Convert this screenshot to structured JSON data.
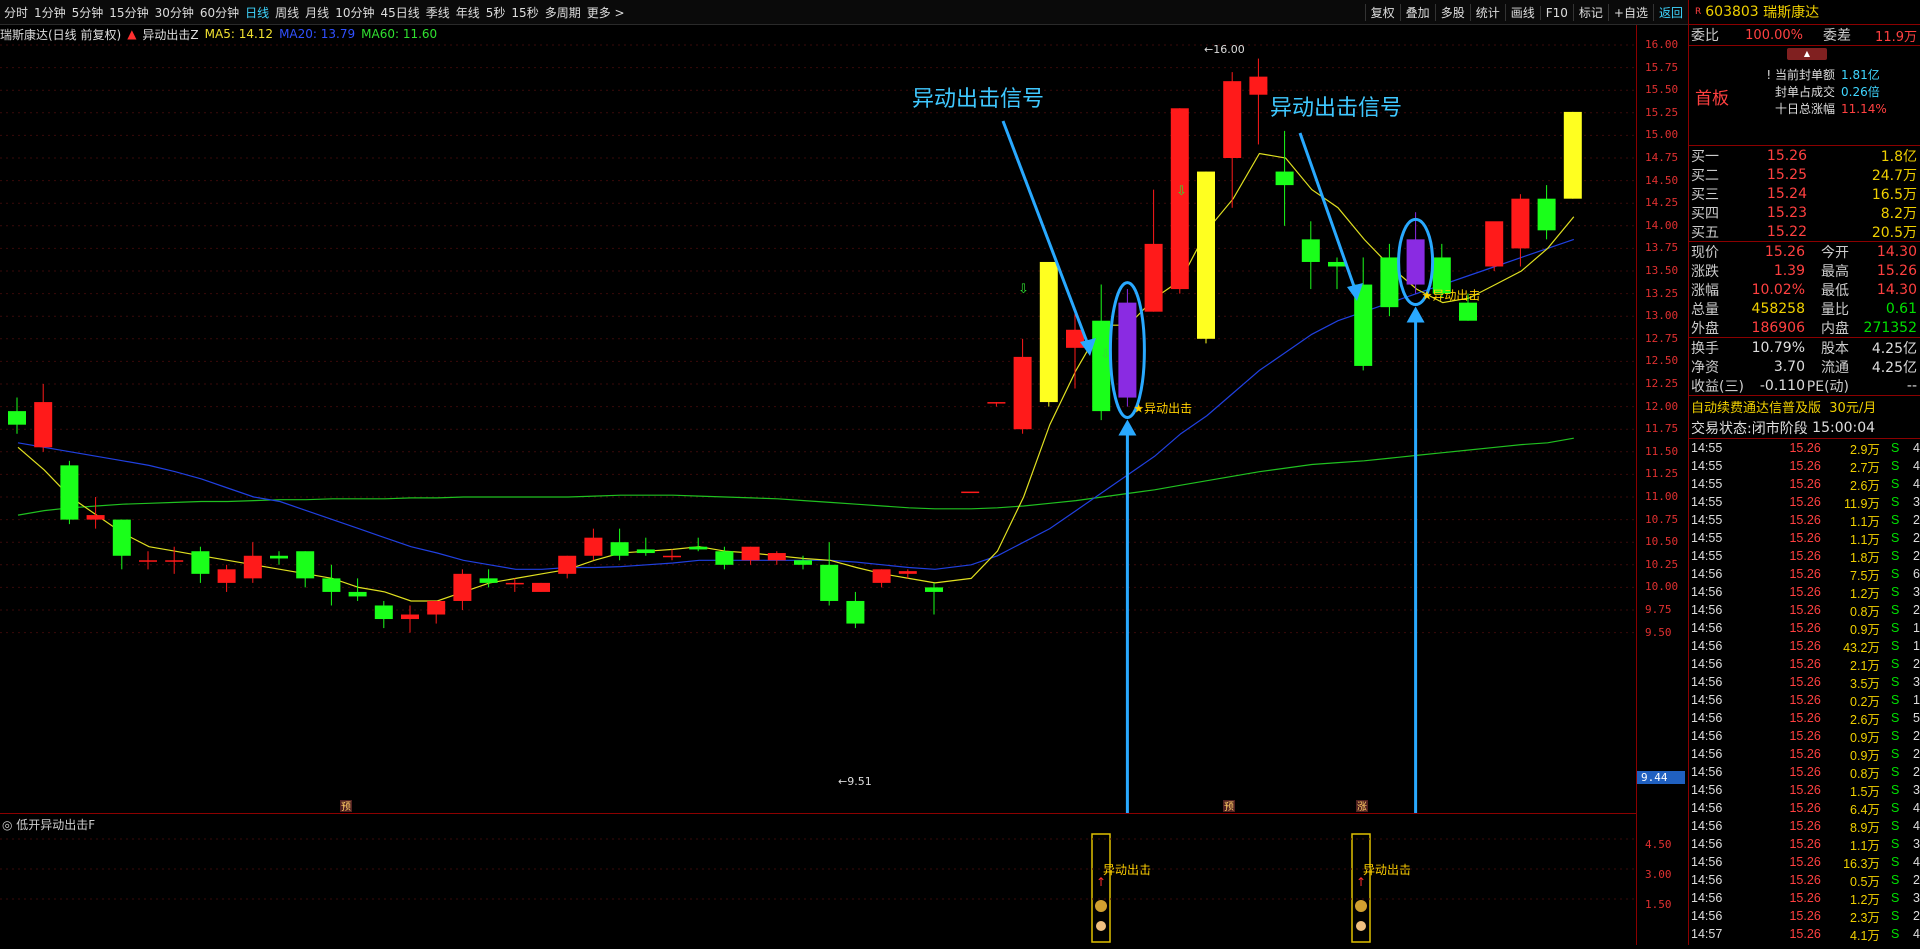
{
  "toolbar": {
    "periods": [
      "分时",
      "1分钟",
      "5分钟",
      "15分钟",
      "30分钟",
      "60分钟",
      "日线",
      "周线",
      "月线",
      "10分钟",
      "45日线",
      "季线",
      "年线",
      "5秒",
      "15秒",
      "多周期",
      "更多 >"
    ],
    "active_period": "日线",
    "tools": [
      "复权",
      "叠加",
      "多股",
      "统计",
      "画线",
      "F10",
      "标记",
      "+自选",
      "返回"
    ]
  },
  "info": {
    "stock_title": "瑞斯康达(日线 前复权)",
    "indicator": "异动出击Z",
    "ma5": "MA5: 14.12",
    "ma20": "MA20: 13.79",
    "ma60": "MA60: 11.60"
  },
  "sub": {
    "title": "低开异动出击F",
    "marker_label": "异动出击",
    "ticks": [
      "4.50",
      "3.00",
      "1.50"
    ]
  },
  "annotations": {
    "callout_text": "异动出击信号",
    "signal_label": "★异动出击",
    "high_label": "←16.00",
    "low_label": "←9.51",
    "current_price": "9.44",
    "event_a": "预",
    "event_b": "预",
    "event_c": "涨"
  },
  "axis": {
    "ticks": [
      "16.00",
      "15.75",
      "15.50",
      "15.25",
      "15.00",
      "14.75",
      "14.50",
      "14.25",
      "14.00",
      "13.75",
      "13.50",
      "13.25",
      "13.00",
      "12.75",
      "12.50",
      "12.25",
      "12.00",
      "11.75",
      "11.50",
      "11.25",
      "11.00",
      "10.75",
      "10.50",
      "10.25",
      "10.00",
      "9.75",
      "9.50"
    ]
  },
  "quote": {
    "code": "603803",
    "name": "瑞斯康达",
    "tag": "R",
    "weibi_label": "委比",
    "weibi": "100.00%",
    "weicha_label": "委差",
    "weicha": "11.9万",
    "board": "首板",
    "seal_lines": [
      [
        "当前封单额",
        "1.81亿"
      ],
      [
        "封单占成交",
        "0.26倍"
      ],
      [
        "十日总涨幅",
        "11.14%"
      ]
    ],
    "bids": [
      [
        "买一",
        "15.26",
        "1.8亿"
      ],
      [
        "买二",
        "15.25",
        "24.7万"
      ],
      [
        "买三",
        "15.24",
        "16.5万"
      ],
      [
        "买四",
        "15.23",
        "8.2万"
      ],
      [
        "买五",
        "15.22",
        "20.5万"
      ]
    ],
    "stats": [
      [
        "现价",
        "15.26",
        "今开",
        "14.30"
      ],
      [
        "涨跌",
        "1.39",
        "最高",
        "15.26"
      ],
      [
        "涨幅",
        "10.02%",
        "最低",
        "14.30"
      ],
      [
        "总量",
        "458258",
        "量比",
        "0.61"
      ],
      [
        "外盘",
        "186906",
        "内盘",
        "271352"
      ]
    ],
    "stats2": [
      [
        "换手",
        "10.79%",
        "股本",
        "4.25亿"
      ],
      [
        "净资",
        "3.70",
        "流通",
        "4.25亿"
      ],
      [
        "收益(三)",
        "-0.110",
        "PE(动)",
        "--"
      ]
    ],
    "promo": "自动续费通达信普及版",
    "promo_price": "30元/月",
    "status_label": "交易状态:",
    "status": "闭市阶段",
    "status_time": "15:00:04"
  },
  "trades": [
    [
      "14:55",
      "15.26",
      "2.9万",
      "S",
      "4"
    ],
    [
      "14:55",
      "15.26",
      "2.7万",
      "S",
      "4"
    ],
    [
      "14:55",
      "15.26",
      "2.6万",
      "S",
      "4"
    ],
    [
      "14:55",
      "15.26",
      "11.9万",
      "S",
      "3"
    ],
    [
      "14:55",
      "15.26",
      "1.1万",
      "S",
      "2"
    ],
    [
      "14:55",
      "15.26",
      "1.1万",
      "S",
      "2"
    ],
    [
      "14:55",
      "15.26",
      "1.8万",
      "S",
      "2"
    ],
    [
      "14:56",
      "15.26",
      "7.5万",
      "S",
      "6"
    ],
    [
      "14:56",
      "15.26",
      "1.2万",
      "S",
      "3"
    ],
    [
      "14:56",
      "15.26",
      "0.8万",
      "S",
      "2"
    ],
    [
      "14:56",
      "15.26",
      "0.9万",
      "S",
      "1"
    ],
    [
      "14:56",
      "15.26",
      "43.2万",
      "S",
      "1"
    ],
    [
      "14:56",
      "15.26",
      "2.1万",
      "S",
      "2"
    ],
    [
      "14:56",
      "15.26",
      "3.5万",
      "S",
      "3"
    ],
    [
      "14:56",
      "15.26",
      "0.2万",
      "S",
      "1"
    ],
    [
      "14:56",
      "15.26",
      "2.6万",
      "S",
      "5"
    ],
    [
      "14:56",
      "15.26",
      "0.9万",
      "S",
      "2"
    ],
    [
      "14:56",
      "15.26",
      "0.9万",
      "S",
      "2"
    ],
    [
      "14:56",
      "15.26",
      "0.8万",
      "S",
      "2"
    ],
    [
      "14:56",
      "15.26",
      "1.5万",
      "S",
      "3"
    ],
    [
      "14:56",
      "15.26",
      "6.4万",
      "S",
      "4"
    ],
    [
      "14:56",
      "15.26",
      "8.9万",
      "S",
      "4"
    ],
    [
      "14:56",
      "15.26",
      "1.1万",
      "S",
      "3"
    ],
    [
      "14:56",
      "15.26",
      "16.3万",
      "S",
      "4"
    ],
    [
      "14:56",
      "15.26",
      "0.5万",
      "S",
      "2"
    ],
    [
      "14:56",
      "15.26",
      "1.2万",
      "S",
      "3"
    ],
    [
      "14:56",
      "15.26",
      "2.3万",
      "S",
      "2"
    ],
    [
      "14:57",
      "15.26",
      "4.1万",
      "S",
      "4"
    ]
  ],
  "chart_data": {
    "type": "candlestick",
    "title": "瑞斯康达(日线 前复权)",
    "ylim": [
      9.4,
      16.2
    ],
    "candles": [
      {
        "o": 11.95,
        "h": 12.1,
        "l": 11.7,
        "c": 11.8
      },
      {
        "o": 11.55,
        "h": 12.25,
        "l": 11.5,
        "c": 12.05
      },
      {
        "o": 11.35,
        "h": 11.4,
        "l": 10.7,
        "c": 10.75
      },
      {
        "o": 10.75,
        "h": 11.0,
        "l": 10.65,
        "c": 10.8
      },
      {
        "o": 10.75,
        "h": 10.75,
        "l": 10.2,
        "c": 10.35
      },
      {
        "o": 10.3,
        "h": 10.4,
        "l": 10.2,
        "c": 10.3
      },
      {
        "o": 10.3,
        "h": 10.45,
        "l": 10.15,
        "c": 10.3
      },
      {
        "o": 10.4,
        "h": 10.45,
        "l": 10.05,
        "c": 10.15
      },
      {
        "o": 10.05,
        "h": 10.25,
        "l": 9.95,
        "c": 10.2
      },
      {
        "o": 10.1,
        "h": 10.5,
        "l": 10.05,
        "c": 10.35
      },
      {
        "o": 10.35,
        "h": 10.4,
        "l": 10.25,
        "c": 10.32
      },
      {
        "o": 10.4,
        "h": 10.4,
        "l": 10.0,
        "c": 10.1
      },
      {
        "o": 10.1,
        "h": 10.25,
        "l": 9.8,
        "c": 9.95
      },
      {
        "o": 9.95,
        "h": 10.1,
        "l": 9.85,
        "c": 9.9
      },
      {
        "o": 9.8,
        "h": 9.85,
        "l": 9.55,
        "c": 9.65
      },
      {
        "o": 9.65,
        "h": 9.8,
        "l": 9.5,
        "c": 9.7
      },
      {
        "o": 9.7,
        "h": 9.85,
        "l": 9.6,
        "c": 9.85
      },
      {
        "o": 9.85,
        "h": 10.2,
        "l": 9.75,
        "c": 10.15
      },
      {
        "o": 10.1,
        "h": 10.2,
        "l": 10.0,
        "c": 10.05
      },
      {
        "o": 10.05,
        "h": 10.1,
        "l": 9.95,
        "c": 10.05
      },
      {
        "o": 9.95,
        "h": 10.05,
        "l": 9.95,
        "c": 10.05
      },
      {
        "o": 10.15,
        "h": 10.35,
        "l": 10.1,
        "c": 10.35
      },
      {
        "o": 10.35,
        "h": 10.65,
        "l": 10.3,
        "c": 10.55
      },
      {
        "o": 10.5,
        "h": 10.65,
        "l": 10.3,
        "c": 10.35
      },
      {
        "o": 10.42,
        "h": 10.55,
        "l": 10.35,
        "c": 10.38
      },
      {
        "o": 10.35,
        "h": 10.42,
        "l": 10.3,
        "c": 10.35
      },
      {
        "o": 10.45,
        "h": 10.55,
        "l": 10.4,
        "c": 10.42
      },
      {
        "o": 10.4,
        "h": 10.45,
        "l": 10.2,
        "c": 10.25
      },
      {
        "o": 10.3,
        "h": 10.45,
        "l": 10.25,
        "c": 10.45
      },
      {
        "o": 10.3,
        "h": 10.4,
        "l": 10.25,
        "c": 10.38
      },
      {
        "o": 10.3,
        "h": 10.35,
        "l": 10.2,
        "c": 10.25
      },
      {
        "o": 10.25,
        "h": 10.5,
        "l": 9.8,
        "c": 9.85
      },
      {
        "o": 9.85,
        "h": 9.95,
        "l": 9.55,
        "c": 9.6
      },
      {
        "o": 10.05,
        "h": 10.2,
        "l": 10.0,
        "c": 10.2
      },
      {
        "o": 10.15,
        "h": 10.2,
        "l": 10.1,
        "c": 10.18
      },
      {
        "o": 10.0,
        "h": 10.05,
        "l": 9.7,
        "c": 9.95
      },
      {
        "o": 11.06,
        "h": 11.06,
        "l": 11.06,
        "c": 11.06
      },
      {
        "o": 12.05,
        "h": 12.05,
        "l": 12.0,
        "c": 12.05
      },
      {
        "o": 11.75,
        "h": 12.75,
        "l": 11.7,
        "c": 12.55
      },
      {
        "o": 12.05,
        "h": 13.05,
        "l": 12.0,
        "c": 13.6
      },
      {
        "o": 12.65,
        "h": 13.1,
        "l": 12.2,
        "c": 12.85
      },
      {
        "o": 12.95,
        "h": 13.35,
        "l": 11.85,
        "c": 11.95
      },
      {
        "o": 12.1,
        "h": 13.3,
        "l": 12.0,
        "c": 13.15
      },
      {
        "o": 13.05,
        "h": 14.4,
        "l": 13.05,
        "c": 13.8
      },
      {
        "o": 13.3,
        "h": 15.3,
        "l": 13.25,
        "c": 15.3
      },
      {
        "o": 14.6,
        "h": 14.6,
        "l": 12.7,
        "c": 12.75
      },
      {
        "o": 14.75,
        "h": 15.7,
        "l": 14.2,
        "c": 15.6
      },
      {
        "o": 15.45,
        "h": 15.85,
        "l": 14.9,
        "c": 15.65
      },
      {
        "o": 14.6,
        "h": 15.05,
        "l": 14.0,
        "c": 14.45
      },
      {
        "o": 13.85,
        "h": 14.05,
        "l": 13.3,
        "c": 13.6
      },
      {
        "o": 13.6,
        "h": 13.65,
        "l": 13.3,
        "c": 13.55
      },
      {
        "o": 13.35,
        "h": 13.65,
        "l": 12.4,
        "c": 12.45
      },
      {
        "o": 13.65,
        "h": 13.8,
        "l": 13.0,
        "c": 13.1
      },
      {
        "o": 13.85,
        "h": 14.15,
        "l": 13.25,
        "c": 13.35
      },
      {
        "o": 13.65,
        "h": 13.8,
        "l": 13.2,
        "c": 13.25
      },
      {
        "o": 13.15,
        "h": 13.25,
        "l": 12.95,
        "c": 12.95
      },
      {
        "o": 13.55,
        "h": 14.0,
        "l": 13.5,
        "c": 14.05
      },
      {
        "o": 13.75,
        "h": 14.35,
        "l": 13.55,
        "c": 14.3
      },
      {
        "o": 14.3,
        "h": 14.45,
        "l": 13.85,
        "c": 13.95
      },
      {
        "o": 14.3,
        "h": 15.26,
        "l": 14.3,
        "c": 15.26
      }
    ],
    "ma5": [
      11.55,
      11.3,
      11.0,
      10.8,
      10.6,
      10.45,
      10.4,
      10.35,
      10.3,
      10.25,
      10.2,
      10.15,
      10.1,
      10.0,
      9.95,
      9.85,
      9.85,
      9.95,
      10.05,
      10.1,
      10.15,
      10.2,
      10.3,
      10.38,
      10.4,
      10.42,
      10.45,
      10.4,
      10.38,
      10.35,
      10.32,
      10.3,
      10.22,
      10.15,
      10.1,
      10.05,
      10.1,
      10.4,
      11.0,
      11.8,
      12.4,
      12.9,
      12.9,
      13.2,
      13.4,
      13.95,
      14.3,
      14.8,
      14.75,
      14.4,
      14.2,
      13.85,
      13.55,
      13.3,
      13.15,
      13.2,
      13.35,
      13.5,
      13.75,
      14.1
    ],
    "ma20": [
      11.6,
      11.55,
      11.5,
      11.45,
      11.4,
      11.35,
      11.28,
      11.2,
      11.1,
      11.0,
      10.95,
      10.85,
      10.75,
      10.65,
      10.55,
      10.45,
      10.38,
      10.3,
      10.25,
      10.2,
      10.2,
      10.22,
      10.22,
      10.23,
      10.25,
      10.27,
      10.3,
      10.3,
      10.3,
      10.3,
      10.3,
      10.3,
      10.28,
      10.25,
      10.22,
      10.2,
      10.25,
      10.35,
      10.5,
      10.65,
      10.85,
      11.05,
      11.25,
      11.45,
      11.7,
      11.9,
      12.15,
      12.4,
      12.6,
      12.8,
      12.95,
      13.05,
      13.15,
      13.25,
      13.35,
      13.45,
      13.55,
      13.65,
      13.75,
      13.85
    ],
    "ma60": [
      10.8,
      10.85,
      10.88,
      10.9,
      10.92,
      10.93,
      10.94,
      10.95,
      10.95,
      10.96,
      10.97,
      10.97,
      10.98,
      10.98,
      10.98,
      10.99,
      10.99,
      11.0,
      11.0,
      11.0,
      11.0,
      11.0,
      11.01,
      11.02,
      11.02,
      11.02,
      11.01,
      11.0,
      10.99,
      10.98,
      10.96,
      10.94,
      10.92,
      10.9,
      10.88,
      10.87,
      10.87,
      10.88,
      10.9,
      10.93,
      10.96,
      11.0,
      11.04,
      11.08,
      11.13,
      11.18,
      11.23,
      11.28,
      11.32,
      11.36,
      11.38,
      11.4,
      11.43,
      11.46,
      11.49,
      11.52,
      11.55,
      11.58,
      11.6,
      11.65
    ]
  }
}
